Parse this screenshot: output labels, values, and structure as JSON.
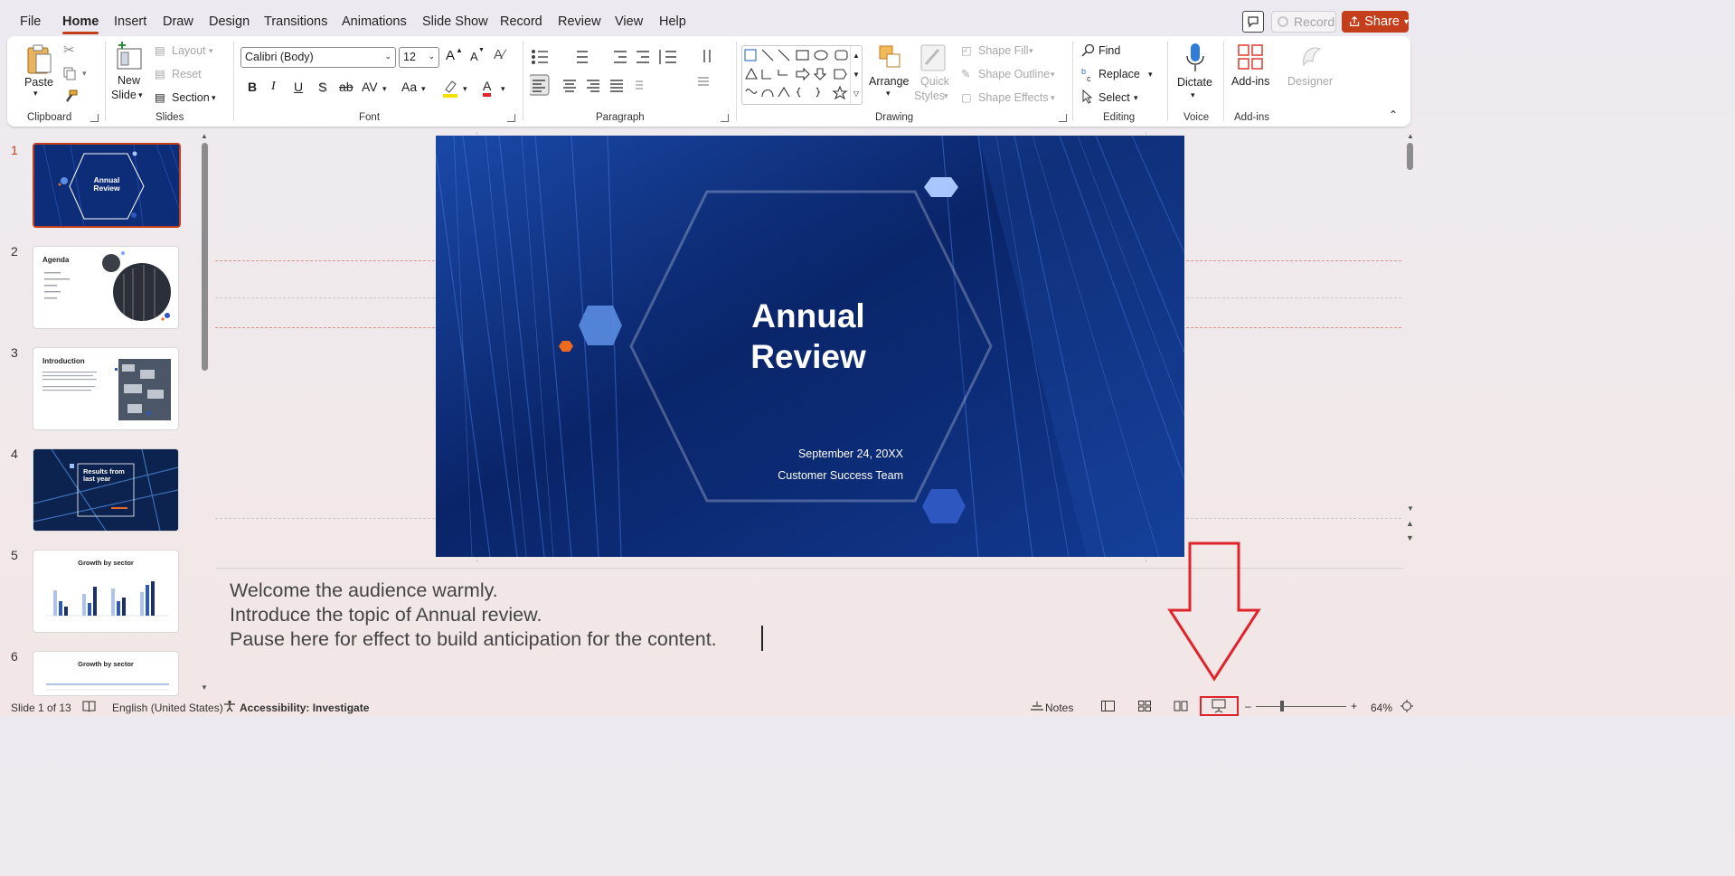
{
  "menu": {
    "tabs": [
      "File",
      "Home",
      "Insert",
      "Draw",
      "Design",
      "Transitions",
      "Animations",
      "Slide Show",
      "Record",
      "Review",
      "View",
      "Help"
    ],
    "active_tab": "Home",
    "record_label": "Record",
    "share_label": "Share"
  },
  "ribbon": {
    "clipboard": {
      "paste": "Paste",
      "label": "Clipboard"
    },
    "slides": {
      "new_slide_1": "New",
      "new_slide_2": "Slide",
      "layout": "Layout",
      "reset": "Reset",
      "section": "Section",
      "label": "Slides"
    },
    "font": {
      "family": "Calibri (Body)",
      "size": "12",
      "bold": "B",
      "italic": "I",
      "underline": "U",
      "shadow": "S",
      "strike": "ab",
      "spacing": "AV",
      "case": "Aa",
      "color_letter": "A",
      "grow": "A",
      "shrink": "A",
      "label": "Font"
    },
    "paragraph": {
      "label": "Paragraph"
    },
    "drawing": {
      "arrange": "Arrange",
      "quick_styles_1": "Quick",
      "quick_styles_2": "Styles",
      "shape_fill": "Shape Fill",
      "shape_outline": "Shape Outline",
      "shape_effects": "Shape Effects",
      "label": "Drawing"
    },
    "editing": {
      "find": "Find",
      "replace": "Replace",
      "select": "Select",
      "label": "Editing"
    },
    "voice": {
      "dictate": "Dictate",
      "label": "Voice"
    },
    "addins": {
      "addins": "Add-ins",
      "label": "Add-ins",
      "designer": "Designer"
    }
  },
  "thumbnails": [
    {
      "num": "1",
      "title_1": "Annual",
      "title_2": "Review"
    },
    {
      "num": "2",
      "title": "Agenda"
    },
    {
      "num": "3",
      "title": "Introduction"
    },
    {
      "num": "4",
      "title_1": "Results from",
      "title_2": "last year"
    },
    {
      "num": "5",
      "title": "Growth by sector"
    },
    {
      "num": "6",
      "title": "Growth by sector"
    }
  ],
  "slide": {
    "title_1": "Annual",
    "title_2": "Review",
    "date": "September 24, 20XX",
    "team": "Customer Success Team"
  },
  "notes": {
    "line1": "Welcome the audience warmly.",
    "line2": "Introduce the topic of Annual review.",
    "line3": "Pause here for effect to build anticipation for the content."
  },
  "status": {
    "slide_info": "Slide 1 of 13",
    "language": "English (United States)",
    "accessibility": "Accessibility: Investigate",
    "notes": "Notes",
    "zoom": "64%"
  },
  "colors": {
    "accent": "#c43e1c",
    "slide_bg": "#0c2a72",
    "annotation": "#e0242b"
  }
}
